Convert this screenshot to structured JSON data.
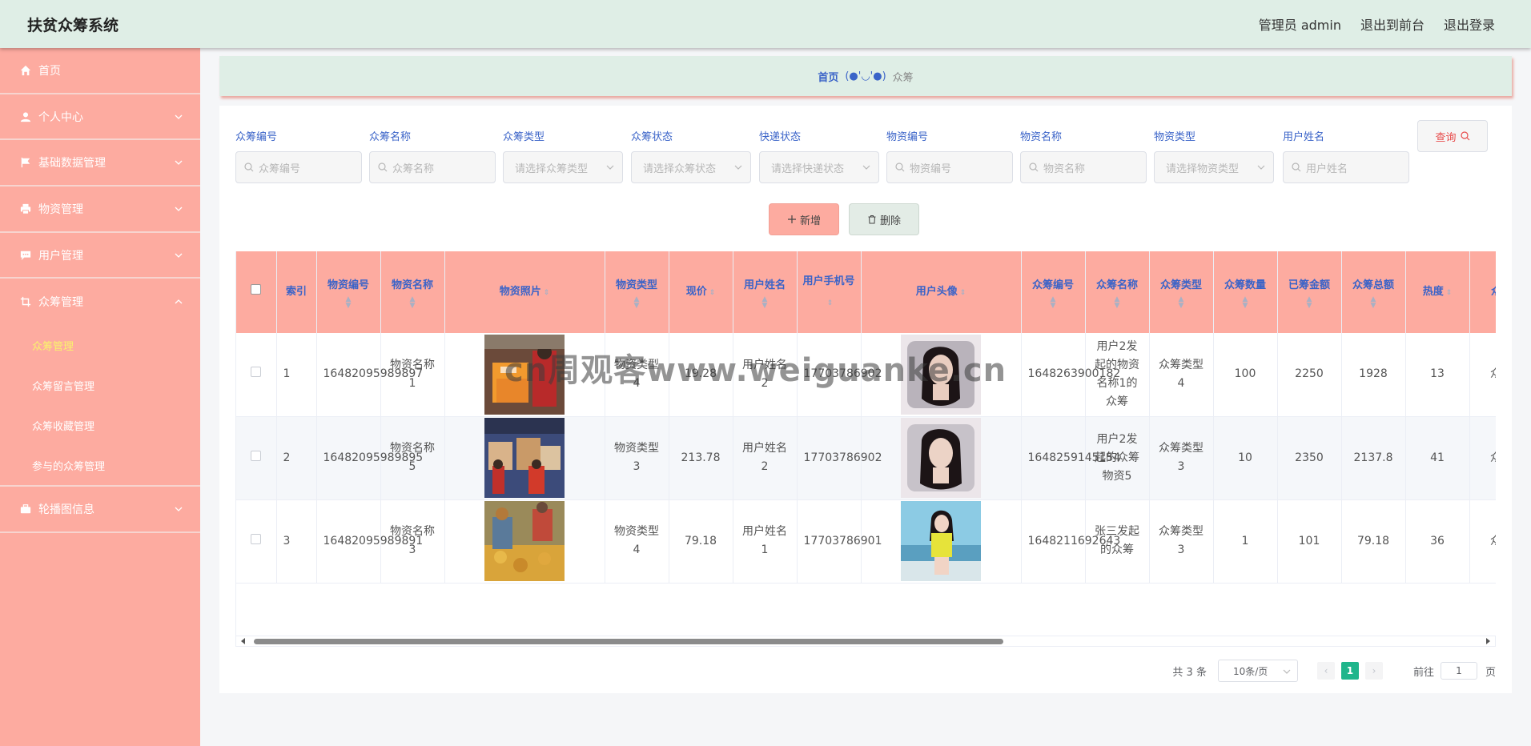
{
  "header": {
    "app_title": "扶贫众筹系统",
    "admin_label": "管理员 admin",
    "to_front_label": "退出到前台",
    "logout_label": "退出登录"
  },
  "sidebar": {
    "items": [
      {
        "label": "首页",
        "icon": "home-icon"
      },
      {
        "label": "个人中心",
        "icon": "user-icon"
      },
      {
        "label": "基础数据管理",
        "icon": "flag-icon"
      },
      {
        "label": "物资管理",
        "icon": "printer-icon"
      },
      {
        "label": "用户管理",
        "icon": "chat-icon"
      },
      {
        "label": "众筹管理",
        "icon": "crop-icon"
      }
    ],
    "sub_items": [
      {
        "label": "众筹管理",
        "active": true
      },
      {
        "label": "众筹留言管理"
      },
      {
        "label": "众筹收藏管理"
      },
      {
        "label": "参与的众筹管理"
      }
    ],
    "last_item": {
      "label": "轮播图信息",
      "icon": "briefcase-icon"
    }
  },
  "breadcrumb": {
    "home": "首页",
    "separator": "(●'◡'●)",
    "current": "众筹"
  },
  "search": {
    "fields": [
      {
        "label": "众筹编号",
        "placeholder": "众筹编号",
        "type": "input"
      },
      {
        "label": "众筹名称",
        "placeholder": "众筹名称",
        "type": "input"
      },
      {
        "label": "众筹类型",
        "placeholder": "请选择众筹类型",
        "type": "select"
      },
      {
        "label": "众筹状态",
        "placeholder": "请选择众筹状态",
        "type": "select"
      },
      {
        "label": "快递状态",
        "placeholder": "请选择快递状态",
        "type": "select"
      },
      {
        "label": "物资编号",
        "placeholder": "物资编号",
        "type": "input"
      },
      {
        "label": "物资名称",
        "placeholder": "物资名称",
        "type": "input"
      },
      {
        "label": "物资类型",
        "placeholder": "请选择物资类型",
        "type": "select"
      },
      {
        "label": "用户姓名",
        "placeholder": "用户姓名",
        "type": "input"
      }
    ],
    "query_label": "查询"
  },
  "actions": {
    "add_label": "新增",
    "delete_label": "删除"
  },
  "table": {
    "headers": {
      "index": "索引",
      "material_no": "物资编号",
      "material_name": "物资名称",
      "material_photo": "物资照片",
      "material_type": "物资类型",
      "price": "现价",
      "user_name": "用户姓名",
      "user_phone": "用户手机号",
      "user_avatar": "用户头像",
      "crowd_no": "众筹编号",
      "crowd_name": "众筹名称",
      "crowd_type": "众筹类型",
      "crowd_count": "众筹数量",
      "raised": "已筹金额",
      "total": "众筹总额",
      "heat": "热度",
      "more": "众筹"
    },
    "rows": [
      {
        "index": "1",
        "material_no": "16482095989897",
        "material_name": "物资名称1",
        "material_type": "物资类型4",
        "price": "19.28",
        "user_name": "用户姓名2",
        "user_phone": "17703786902",
        "crowd_no": "1648263900182",
        "crowd_name": "用户2发起的物资名称1的众筹",
        "crowd_type": "众筹类型4",
        "crowd_count": "100",
        "raised": "2250",
        "total": "1928",
        "heat": "13",
        "more": "众筹"
      },
      {
        "index": "2",
        "material_no": "16482095989895",
        "material_name": "物资名称5",
        "material_type": "物资类型3",
        "price": "213.78",
        "user_name": "用户姓名2",
        "user_phone": "17703786902",
        "crowd_no": "1648259145154",
        "crowd_name": "用户2发起的众筹物资5",
        "crowd_type": "众筹类型3",
        "crowd_count": "10",
        "raised": "2350",
        "total": "2137.8",
        "heat": "41",
        "more": "众筹"
      },
      {
        "index": "3",
        "material_no": "16482095989891",
        "material_name": "物资名称3",
        "material_type": "物资类型4",
        "price": "79.18",
        "user_name": "用户姓名1",
        "user_phone": "17703786901",
        "crowd_no": "1648211692643",
        "crowd_name": "张三发起的众筹",
        "crowd_type": "众筹类型3",
        "crowd_count": "1",
        "raised": "101",
        "total": "79.18",
        "heat": "36",
        "more": "众筹"
      }
    ]
  },
  "pagination": {
    "total_label": "共 3 条",
    "page_size": "10条/页",
    "current_page": "1",
    "goto_label": "前往",
    "goto_value": "1",
    "page_suffix": "页"
  },
  "watermark": "cn周观客www.weiguanke.cn",
  "colors": {
    "sidebar_bg": "#fdaba0",
    "header_bg": "#dfeee6",
    "accent_blue": "#3a63c8",
    "active_sub": "#f9f46b",
    "pager_active": "#1fb58b"
  }
}
